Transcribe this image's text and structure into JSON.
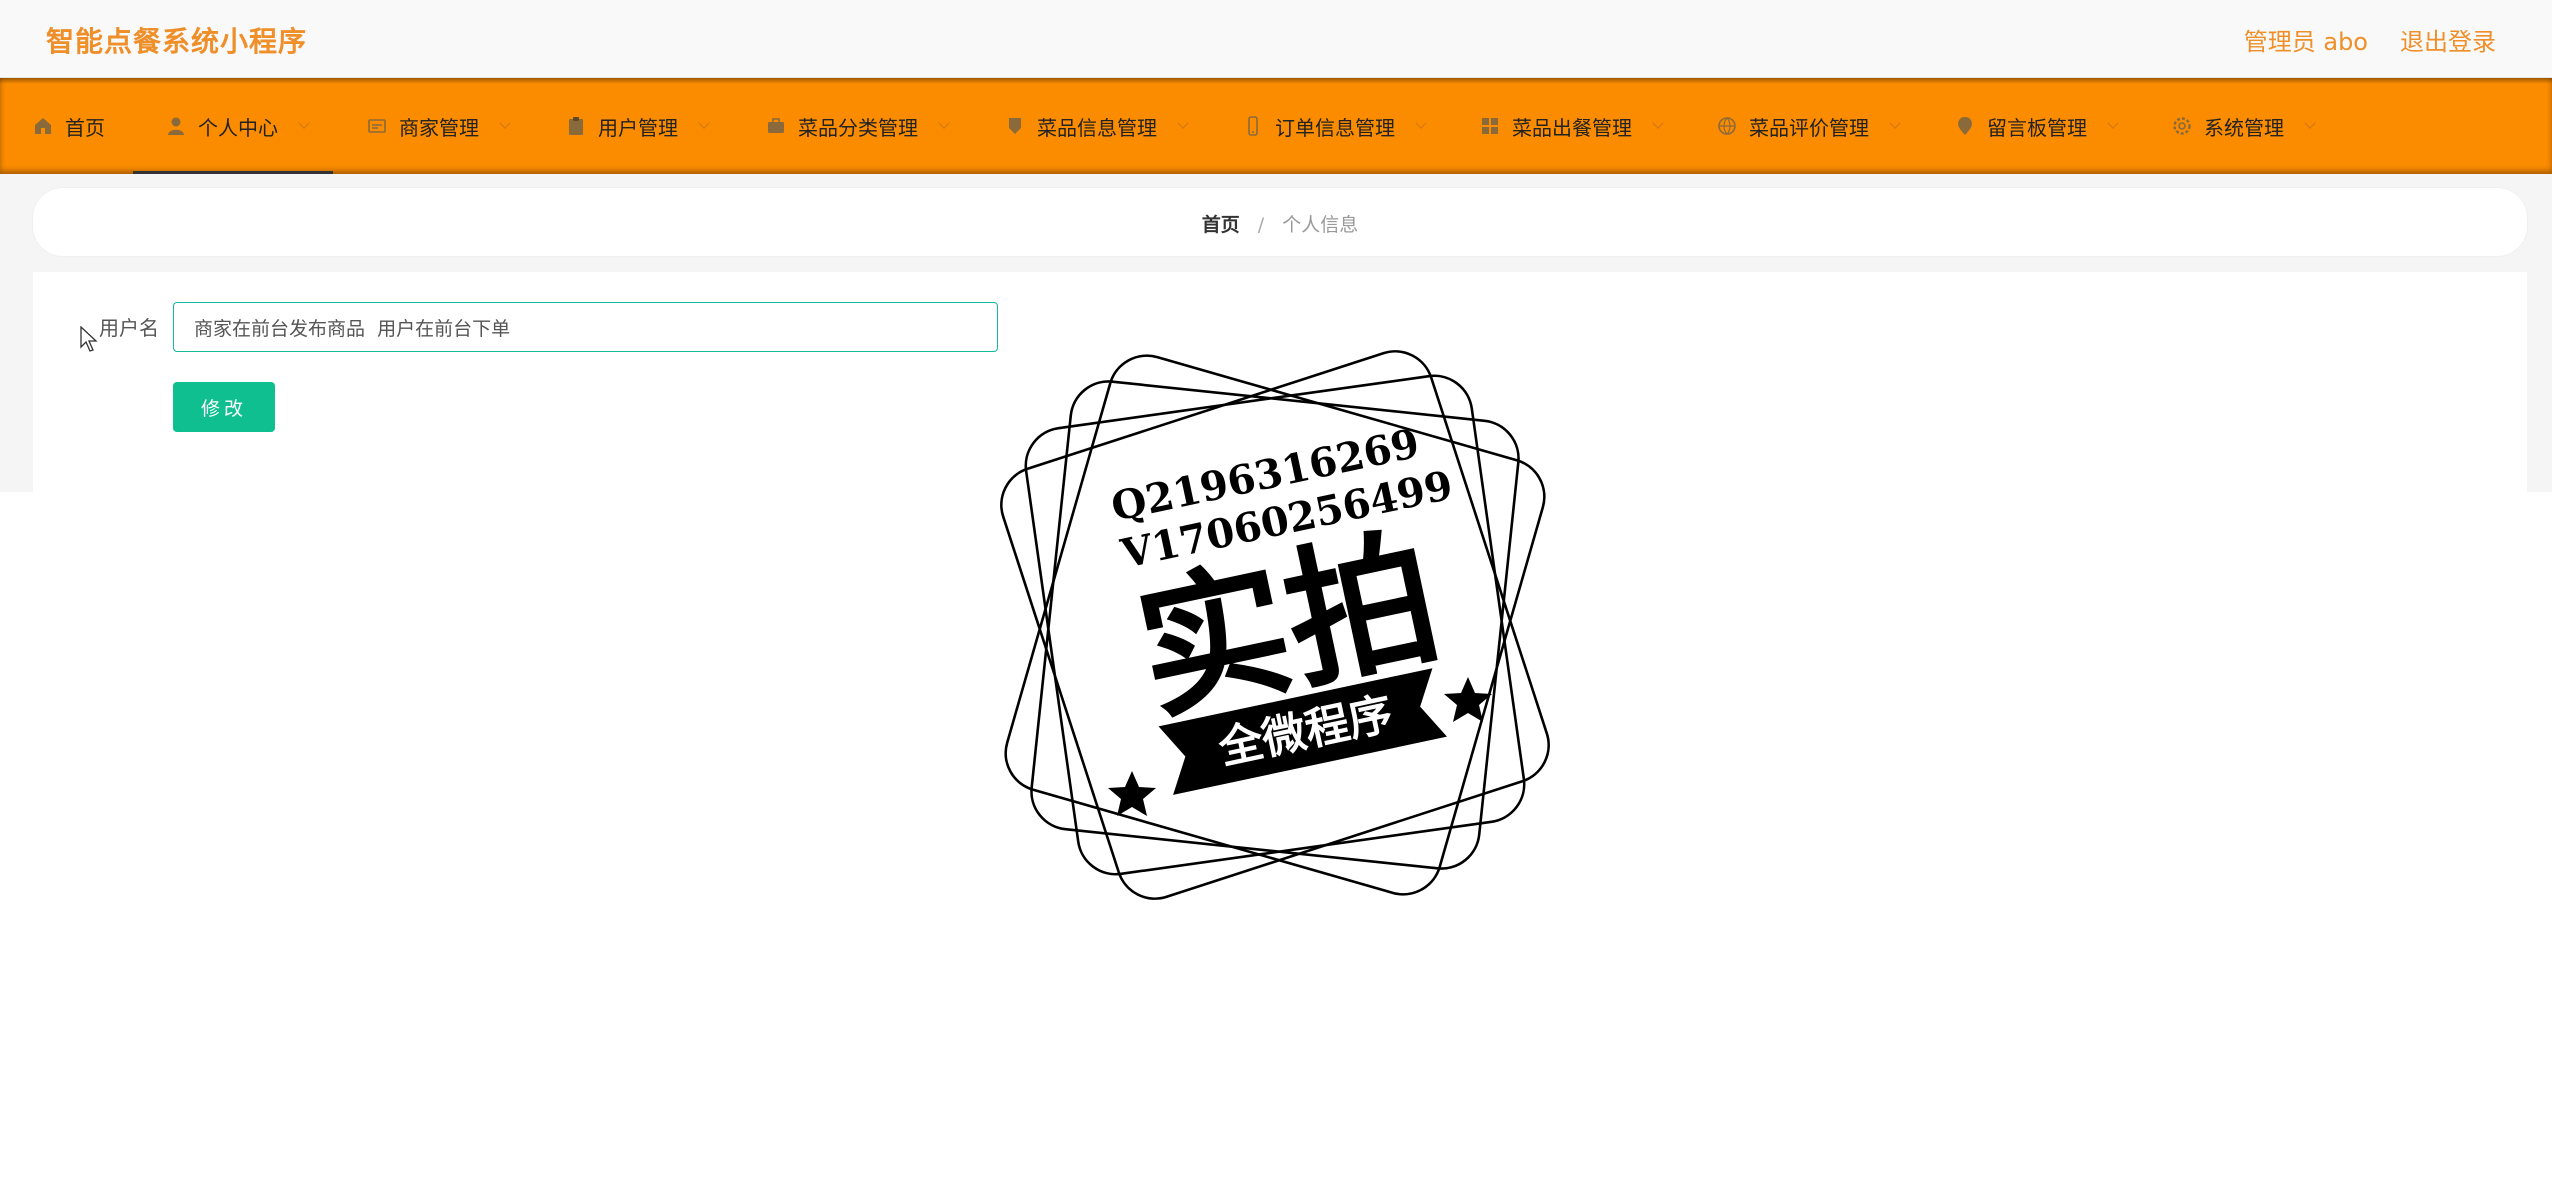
{
  "header": {
    "app_title": "智能点餐系统小程序",
    "user_label": "管理员 abo",
    "logout_label": "退出登录"
  },
  "nav": {
    "items": [
      {
        "label": "首页",
        "icon": "home-icon"
      },
      {
        "label": "个人中心",
        "icon": "user-icon"
      },
      {
        "label": "商家管理",
        "icon": "store-icon"
      },
      {
        "label": "用户管理",
        "icon": "clipboard-icon"
      },
      {
        "label": "菜品分类管理",
        "icon": "briefcase-icon"
      },
      {
        "label": "菜品信息管理",
        "icon": "tag-icon"
      },
      {
        "label": "订单信息管理",
        "icon": "phone-icon"
      },
      {
        "label": "菜品出餐管理",
        "icon": "grid-icon"
      },
      {
        "label": "菜品评价管理",
        "icon": "globe-icon"
      },
      {
        "label": "留言板管理",
        "icon": "pin-icon"
      },
      {
        "label": "系统管理",
        "icon": "gear-icon"
      }
    ],
    "active_index": 1
  },
  "breadcrumb": {
    "home": "首页",
    "separator": "/",
    "current": "个人信息"
  },
  "form": {
    "username_label": "用户名",
    "username_value": "商家在前台发布商品  用户在前台下单",
    "submit_label": "修改"
  },
  "watermark": {
    "line1": "Q2196316269",
    "line2": "V17060256499",
    "main": "实拍",
    "banner": "全微程序"
  },
  "colors": {
    "accent": "#ef8f2a",
    "nav_bg": "#fb8c00",
    "input_border": "#15b9a0",
    "button_bg": "#0fbf8f"
  }
}
